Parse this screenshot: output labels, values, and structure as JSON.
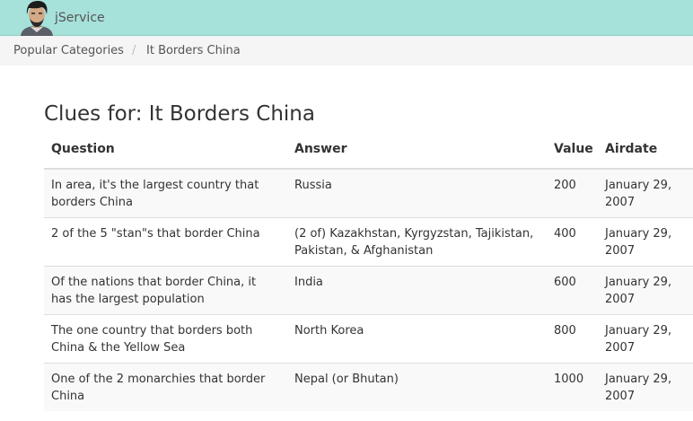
{
  "header": {
    "brand": "jService"
  },
  "breadcrumb": [
    "Popular Categories",
    "It Borders China"
  ],
  "page": {
    "title": "Clues for: It Borders China"
  },
  "table": {
    "columns": [
      "Question",
      "Answer",
      "Value",
      "Airdate"
    ],
    "rows": [
      {
        "question": "In area, it's the largest country that borders China",
        "answer": "Russia",
        "value": "200",
        "airdate": "January 29, 2007"
      },
      {
        "question": "2 of the 5 \"stan\"s that border China",
        "answer": "(2 of) Kazakhstan, Kyrgyzstan, Tajikistan, Pakistan, & Afghanistan",
        "value": "400",
        "airdate": "January 29, 2007"
      },
      {
        "question": "Of the nations that border China, it has the largest population",
        "answer": "India",
        "value": "600",
        "airdate": "January 29, 2007"
      },
      {
        "question": "The one country that borders both China & the Yellow Sea",
        "answer": "North Korea",
        "value": "800",
        "airdate": "January 29, 2007"
      },
      {
        "question": "One of the 2 monarchies that border China",
        "answer": "Nepal (or Bhutan)",
        "value": "1000",
        "airdate": "January 29, 2007"
      }
    ]
  }
}
